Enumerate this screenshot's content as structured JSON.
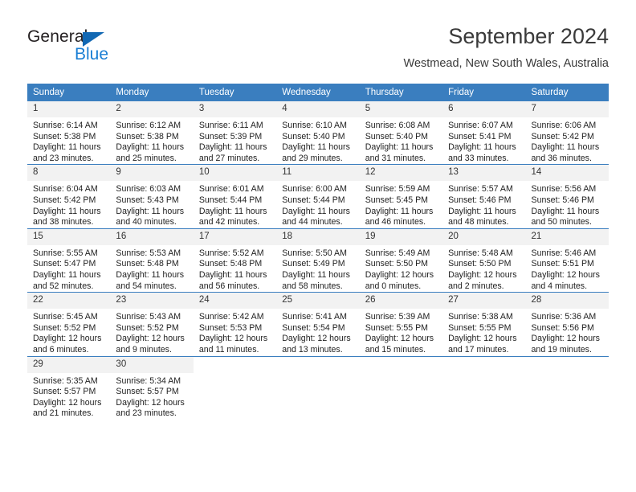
{
  "brand": {
    "name_part1": "General",
    "name_part2": "Blue",
    "triangle_icon": "triangle-icon",
    "accent_dark": "#231f20",
    "accent_blue": "#1b7fd4",
    "triangle_color": "#1268b3"
  },
  "header": {
    "title": "September 2024",
    "subtitle": "Westmead, New South Wales, Australia"
  },
  "theme": {
    "header_row_bg": "#3a7ebf",
    "header_row_text": "#ffffff",
    "daynum_bg": "#f2f2f2",
    "grid_line": "#3a7ebf",
    "body_text": "#222222"
  },
  "weekdays": [
    "Sunday",
    "Monday",
    "Tuesday",
    "Wednesday",
    "Thursday",
    "Friday",
    "Saturday"
  ],
  "weeks": [
    [
      {
        "day": "1",
        "sunrise": "Sunrise: 6:14 AM",
        "sunset": "Sunset: 5:38 PM",
        "daylight1": "Daylight: 11 hours",
        "daylight2": "and 23 minutes."
      },
      {
        "day": "2",
        "sunrise": "Sunrise: 6:12 AM",
        "sunset": "Sunset: 5:38 PM",
        "daylight1": "Daylight: 11 hours",
        "daylight2": "and 25 minutes."
      },
      {
        "day": "3",
        "sunrise": "Sunrise: 6:11 AM",
        "sunset": "Sunset: 5:39 PM",
        "daylight1": "Daylight: 11 hours",
        "daylight2": "and 27 minutes."
      },
      {
        "day": "4",
        "sunrise": "Sunrise: 6:10 AM",
        "sunset": "Sunset: 5:40 PM",
        "daylight1": "Daylight: 11 hours",
        "daylight2": "and 29 minutes."
      },
      {
        "day": "5",
        "sunrise": "Sunrise: 6:08 AM",
        "sunset": "Sunset: 5:40 PM",
        "daylight1": "Daylight: 11 hours",
        "daylight2": "and 31 minutes."
      },
      {
        "day": "6",
        "sunrise": "Sunrise: 6:07 AM",
        "sunset": "Sunset: 5:41 PM",
        "daylight1": "Daylight: 11 hours",
        "daylight2": "and 33 minutes."
      },
      {
        "day": "7",
        "sunrise": "Sunrise: 6:06 AM",
        "sunset": "Sunset: 5:42 PM",
        "daylight1": "Daylight: 11 hours",
        "daylight2": "and 36 minutes."
      }
    ],
    [
      {
        "day": "8",
        "sunrise": "Sunrise: 6:04 AM",
        "sunset": "Sunset: 5:42 PM",
        "daylight1": "Daylight: 11 hours",
        "daylight2": "and 38 minutes."
      },
      {
        "day": "9",
        "sunrise": "Sunrise: 6:03 AM",
        "sunset": "Sunset: 5:43 PM",
        "daylight1": "Daylight: 11 hours",
        "daylight2": "and 40 minutes."
      },
      {
        "day": "10",
        "sunrise": "Sunrise: 6:01 AM",
        "sunset": "Sunset: 5:44 PM",
        "daylight1": "Daylight: 11 hours",
        "daylight2": "and 42 minutes."
      },
      {
        "day": "11",
        "sunrise": "Sunrise: 6:00 AM",
        "sunset": "Sunset: 5:44 PM",
        "daylight1": "Daylight: 11 hours",
        "daylight2": "and 44 minutes."
      },
      {
        "day": "12",
        "sunrise": "Sunrise: 5:59 AM",
        "sunset": "Sunset: 5:45 PM",
        "daylight1": "Daylight: 11 hours",
        "daylight2": "and 46 minutes."
      },
      {
        "day": "13",
        "sunrise": "Sunrise: 5:57 AM",
        "sunset": "Sunset: 5:46 PM",
        "daylight1": "Daylight: 11 hours",
        "daylight2": "and 48 minutes."
      },
      {
        "day": "14",
        "sunrise": "Sunrise: 5:56 AM",
        "sunset": "Sunset: 5:46 PM",
        "daylight1": "Daylight: 11 hours",
        "daylight2": "and 50 minutes."
      }
    ],
    [
      {
        "day": "15",
        "sunrise": "Sunrise: 5:55 AM",
        "sunset": "Sunset: 5:47 PM",
        "daylight1": "Daylight: 11 hours",
        "daylight2": "and 52 minutes."
      },
      {
        "day": "16",
        "sunrise": "Sunrise: 5:53 AM",
        "sunset": "Sunset: 5:48 PM",
        "daylight1": "Daylight: 11 hours",
        "daylight2": "and 54 minutes."
      },
      {
        "day": "17",
        "sunrise": "Sunrise: 5:52 AM",
        "sunset": "Sunset: 5:48 PM",
        "daylight1": "Daylight: 11 hours",
        "daylight2": "and 56 minutes."
      },
      {
        "day": "18",
        "sunrise": "Sunrise: 5:50 AM",
        "sunset": "Sunset: 5:49 PM",
        "daylight1": "Daylight: 11 hours",
        "daylight2": "and 58 minutes."
      },
      {
        "day": "19",
        "sunrise": "Sunrise: 5:49 AM",
        "sunset": "Sunset: 5:50 PM",
        "daylight1": "Daylight: 12 hours",
        "daylight2": "and 0 minutes."
      },
      {
        "day": "20",
        "sunrise": "Sunrise: 5:48 AM",
        "sunset": "Sunset: 5:50 PM",
        "daylight1": "Daylight: 12 hours",
        "daylight2": "and 2 minutes."
      },
      {
        "day": "21",
        "sunrise": "Sunrise: 5:46 AM",
        "sunset": "Sunset: 5:51 PM",
        "daylight1": "Daylight: 12 hours",
        "daylight2": "and 4 minutes."
      }
    ],
    [
      {
        "day": "22",
        "sunrise": "Sunrise: 5:45 AM",
        "sunset": "Sunset: 5:52 PM",
        "daylight1": "Daylight: 12 hours",
        "daylight2": "and 6 minutes."
      },
      {
        "day": "23",
        "sunrise": "Sunrise: 5:43 AM",
        "sunset": "Sunset: 5:52 PM",
        "daylight1": "Daylight: 12 hours",
        "daylight2": "and 9 minutes."
      },
      {
        "day": "24",
        "sunrise": "Sunrise: 5:42 AM",
        "sunset": "Sunset: 5:53 PM",
        "daylight1": "Daylight: 12 hours",
        "daylight2": "and 11 minutes."
      },
      {
        "day": "25",
        "sunrise": "Sunrise: 5:41 AM",
        "sunset": "Sunset: 5:54 PM",
        "daylight1": "Daylight: 12 hours",
        "daylight2": "and 13 minutes."
      },
      {
        "day": "26",
        "sunrise": "Sunrise: 5:39 AM",
        "sunset": "Sunset: 5:55 PM",
        "daylight1": "Daylight: 12 hours",
        "daylight2": "and 15 minutes."
      },
      {
        "day": "27",
        "sunrise": "Sunrise: 5:38 AM",
        "sunset": "Sunset: 5:55 PM",
        "daylight1": "Daylight: 12 hours",
        "daylight2": "and 17 minutes."
      },
      {
        "day": "28",
        "sunrise": "Sunrise: 5:36 AM",
        "sunset": "Sunset: 5:56 PM",
        "daylight1": "Daylight: 12 hours",
        "daylight2": "and 19 minutes."
      }
    ],
    [
      {
        "day": "29",
        "sunrise": "Sunrise: 5:35 AM",
        "sunset": "Sunset: 5:57 PM",
        "daylight1": "Daylight: 12 hours",
        "daylight2": "and 21 minutes."
      },
      {
        "day": "30",
        "sunrise": "Sunrise: 5:34 AM",
        "sunset": "Sunset: 5:57 PM",
        "daylight1": "Daylight: 12 hours",
        "daylight2": "and 23 minutes."
      },
      {
        "day": "",
        "sunrise": "",
        "sunset": "",
        "daylight1": "",
        "daylight2": ""
      },
      {
        "day": "",
        "sunrise": "",
        "sunset": "",
        "daylight1": "",
        "daylight2": ""
      },
      {
        "day": "",
        "sunrise": "",
        "sunset": "",
        "daylight1": "",
        "daylight2": ""
      },
      {
        "day": "",
        "sunrise": "",
        "sunset": "",
        "daylight1": "",
        "daylight2": ""
      },
      {
        "day": "",
        "sunrise": "",
        "sunset": "",
        "daylight1": "",
        "daylight2": ""
      }
    ]
  ]
}
